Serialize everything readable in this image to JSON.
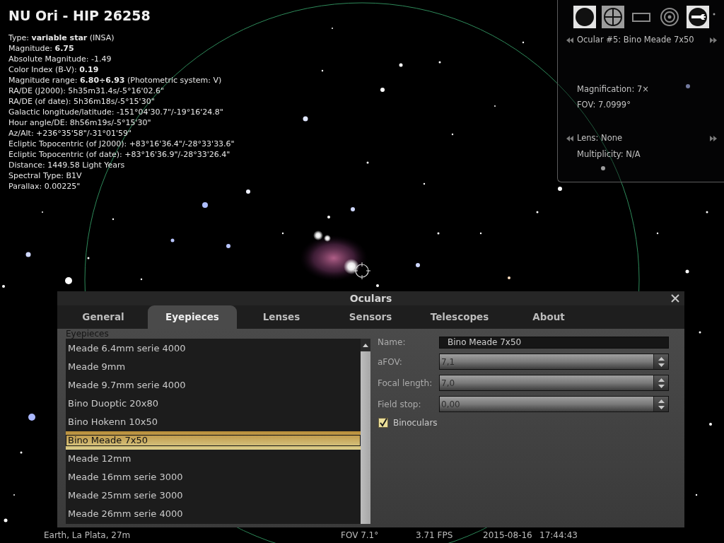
{
  "object_info": {
    "title": "NU Ori - HIP 26258",
    "lines": [
      "Type: **variable star** (INSA)",
      "Magnitude: **6.75**",
      "Absolute Magnitude: -1.49",
      "Color Index (B-V): **0.19**",
      "Magnitude range: **6.80÷6.93** (Photometric system: V)",
      "RA/DE (J2000): 5h35m31.4s/-5°16'02.6\"",
      "RA/DE (of date): 5h36m18s/-5°15'30\"",
      "Galactic longitude/latitude: -151°04'30.7\"/-19°16'24.8\"",
      "Hour angle/DE: 8h56m19s/-5°15'30\"",
      "Az/Alt: +236°35'58\"/-31°01'59\"",
      "Ecliptic Topocentric (of J2000): +83°16'36.4\"/-28°33'33.6\"",
      "Ecliptic Topocentric (of date): +83°16'36.9\"/-28°33'26.4\"",
      "Distance: 1449.58 Light Years",
      "Spectral Type: B1V",
      "Parallax: 0.00225\""
    ]
  },
  "ocular_panel": {
    "buttons": [
      {
        "kind": "ocular",
        "on": true,
        "hovered": false
      },
      {
        "kind": "crosshair",
        "on": false,
        "hovered": true
      },
      {
        "kind": "sensor",
        "on": false,
        "hovered": false
      },
      {
        "kind": "telrad",
        "on": false,
        "hovered": false
      },
      {
        "kind": "settings",
        "on": true,
        "hovered": false
      }
    ],
    "ocular": "Ocular #5: Bino Meade 7x50",
    "magnification": "Magnification: 7×",
    "fov": "FOV: 7.0999°",
    "lens": "Lens: None",
    "multiplicity": "Multiplicity: N/A"
  },
  "dialog": {
    "title": "Oculars",
    "tabs": [
      {
        "label": "General",
        "selected": false
      },
      {
        "label": "Eyepieces",
        "selected": true
      },
      {
        "label": "Lenses",
        "selected": false
      },
      {
        "label": "Sensors",
        "selected": false
      },
      {
        "label": "Telescopes",
        "selected": false
      },
      {
        "label": "About",
        "selected": false
      }
    ],
    "list": {
      "label": "Eyepieces",
      "items": [
        {
          "label": "Meade 6.4mm serie 4000",
          "selected": false
        },
        {
          "label": "Meade 9mm",
          "selected": false
        },
        {
          "label": "Meade 9.7mm serie 4000",
          "selected": false
        },
        {
          "label": "Bino Duoptic 20x80",
          "selected": false
        },
        {
          "label": "Bino Hokenn 10x50",
          "selected": false
        },
        {
          "label": "Bino Meade 7x50",
          "selected": true
        },
        {
          "label": "Meade 12mm",
          "selected": false
        },
        {
          "label": "Meade 16mm serie 3000",
          "selected": false
        },
        {
          "label": "Meade 25mm serie 3000",
          "selected": false
        },
        {
          "label": "Meade 26mm serie 4000",
          "selected": false
        }
      ]
    },
    "fields": [
      {
        "label": "Name:",
        "kind": "text",
        "value": "Bino Meade 7x50"
      },
      {
        "label": "aFOV:",
        "kind": "spin",
        "value": "7,1"
      },
      {
        "label": "Focal length:",
        "kind": "spin",
        "value": "7,0"
      },
      {
        "label": "Field stop:",
        "kind": "spin",
        "value": "0,00"
      }
    ],
    "binoculars": {
      "label": "Binoculars",
      "checked": true
    }
  },
  "status_bar": {
    "location": "Earth, La Plata, 27m",
    "fov": "FOV 7.1°",
    "fps": "3.71 FPS",
    "date": "2015-08-16",
    "time": "17:44:43"
  }
}
